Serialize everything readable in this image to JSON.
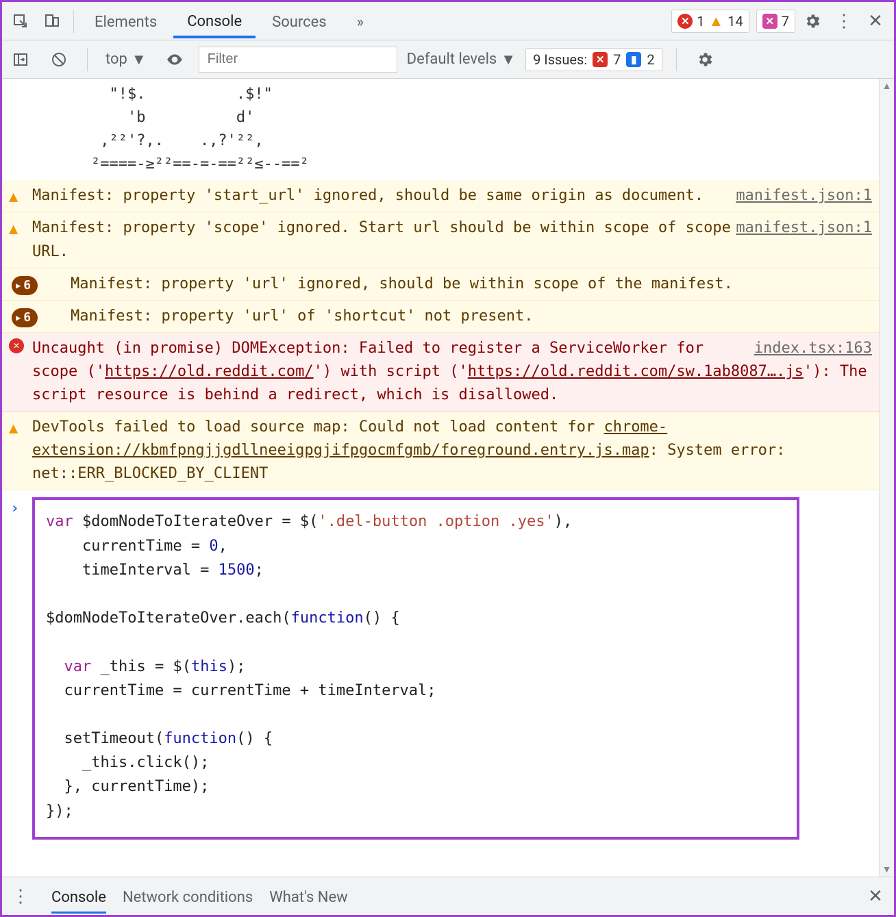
{
  "topbar": {
    "tabs": {
      "elements": "Elements",
      "console": "Console",
      "sources": "Sources",
      "overflow": "»"
    },
    "pill1": {
      "errors": "1",
      "warnings": "14"
    },
    "pill2": {
      "count": "7"
    }
  },
  "toolbar": {
    "context": "top",
    "filter_placeholder": "Filter",
    "levels": "Default levels",
    "issues_label": "9 Issues:",
    "issues_err": "7",
    "issues_info": "2"
  },
  "ascii": "  \"!$.          .$!\"\n    'b          d'\n ,²²'?,.    .,?'²²,\n²====-≥²²==-=-==²²≤--==²",
  "messages": [
    {
      "type": "warn",
      "text": "Manifest: property 'start_url' ignored, should be same origin as document.",
      "src": "manifest.json:1"
    },
    {
      "type": "warn",
      "text": "Manifest: property 'scope' ignored. Start url should be within scope of scope URL.",
      "src": "manifest.json:1"
    },
    {
      "type": "warn",
      "count": "6",
      "text": "Manifest: property 'url' ignored, should be within scope of the manifest."
    },
    {
      "type": "warn",
      "count": "6",
      "text": "Manifest: property 'url' of 'shortcut' not present."
    },
    {
      "type": "err",
      "src": "index.tsx:163",
      "pre": "Uncaught (in promise) DOMException: Failed to register a ServiceWorker for scope ('",
      "link1": "https://old.reddit.com/",
      "mid": "') with script ('",
      "link2": "https://old.reddit.com/sw.1ab8087….js",
      "post": "'): The script resource is behind a redirect, which is disallowed."
    },
    {
      "type": "warn",
      "pre": "DevTools failed to load source map: Could not load content for ",
      "link": "chrome-extension://kbmfpngjjgdllneeigpgjifpgocmfgmb/foreground.entry.js.map",
      "post": ": System error: net::ERR_BLOCKED_BY_CLIENT"
    }
  ],
  "code": {
    "l1a": "var",
    "l1b": " $domNodeToIterateOver = $(",
    "l1c": "'.del-button .option .yes'",
    "l1d": "),",
    "l2a": "    currentTime = ",
    "l2b": "0",
    "l2c": ",",
    "l3a": "    timeInterval = ",
    "l3b": "1500",
    "l3c": ";",
    "blank": "",
    "l5a": "$domNodeToIterateOver.each(",
    "l5b": "function",
    "l5c": "() {",
    "l7a": "  ",
    "l7b": "var",
    "l7c": " _this = $(",
    "l7d": "this",
    "l7e": ");",
    "l8": "  currentTime = currentTime + timeInterval;",
    "l10a": "  setTimeout(",
    "l10b": "function",
    "l10c": "() {",
    "l11": "    _this.click();",
    "l12": "  }, currentTime);",
    "l13": "});"
  },
  "drawer": {
    "tabs": {
      "console": "Console",
      "network": "Network conditions",
      "whatsnew": "What's New"
    }
  }
}
